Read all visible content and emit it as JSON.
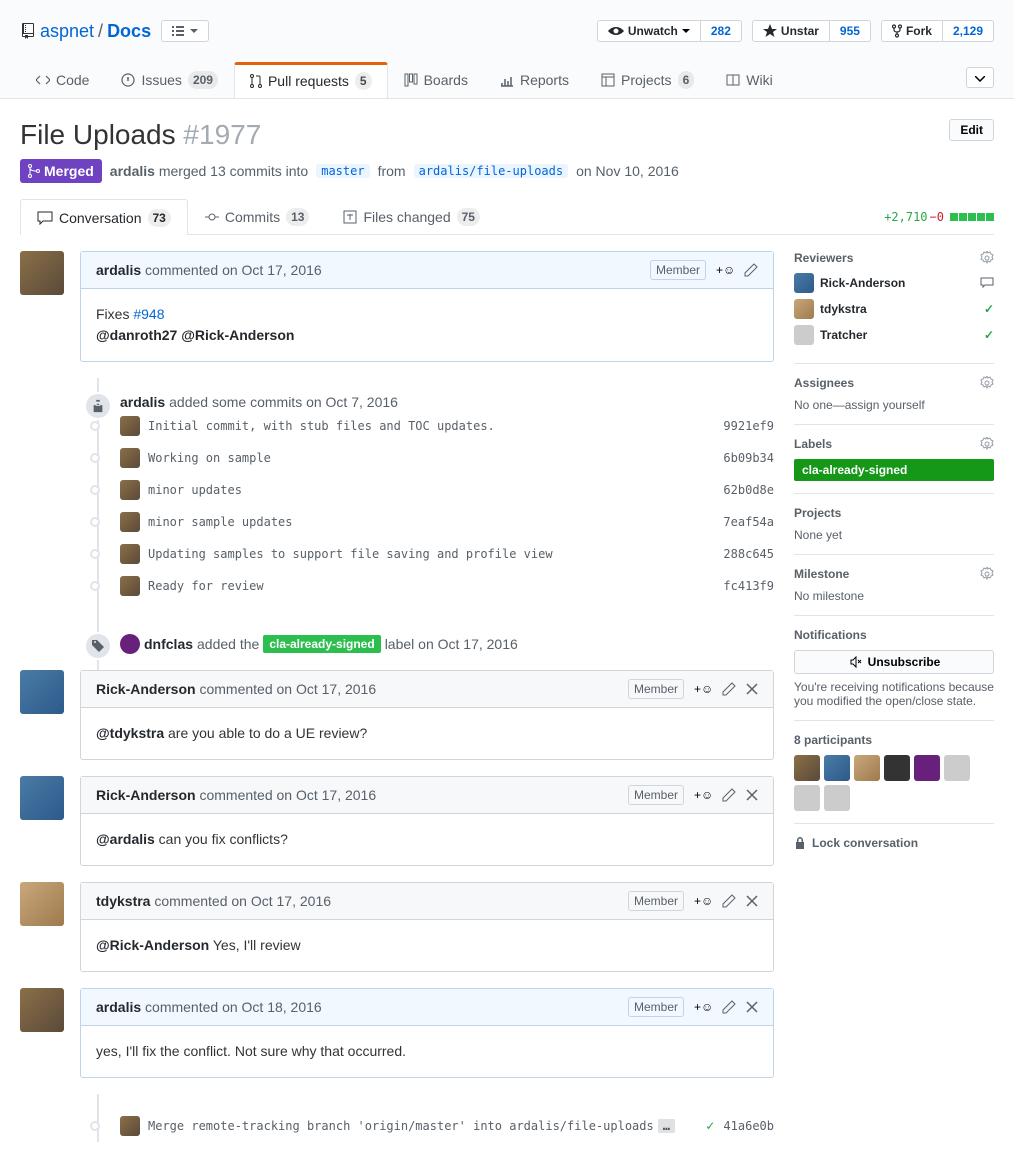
{
  "breadcrumb": {
    "owner": "aspnet",
    "repo": "Docs"
  },
  "actions": {
    "watch": {
      "label": "Unwatch",
      "count": "282"
    },
    "star": {
      "label": "Unstar",
      "count": "955"
    },
    "fork": {
      "label": "Fork",
      "count": "2,129"
    }
  },
  "nav": {
    "code": "Code",
    "issues": {
      "label": "Issues",
      "count": "209"
    },
    "pulls": {
      "label": "Pull requests",
      "count": "5"
    },
    "boards": "Boards",
    "reports": "Reports",
    "projects": {
      "label": "Projects",
      "count": "6"
    },
    "wiki": "Wiki"
  },
  "header": {
    "title": "File Uploads",
    "number": "#1977",
    "edit": "Edit"
  },
  "meta": {
    "state": "Merged",
    "author": "ardalis",
    "text1": "merged 13 commits into",
    "base": "master",
    "text2": "from",
    "head": "ardalis/file-uploads",
    "date": "on Nov 10, 2016"
  },
  "tabs": {
    "conversation": {
      "label": "Conversation",
      "count": "73"
    },
    "commits": {
      "label": "Commits",
      "count": "13"
    },
    "files": {
      "label": "Files changed",
      "count": "75"
    },
    "diff_add": "+2,710",
    "diff_del": "−0"
  },
  "timeline": {
    "c1": {
      "author": "ardalis",
      "meta": "commented on Oct 17, 2016",
      "badge": "Member",
      "body_pre": "Fixes ",
      "issue": "#948",
      "m1": "@danroth27",
      "m2": "@Rick-Anderson"
    },
    "commits_header": {
      "author": "ardalis",
      "text": "added some commits on Oct 7, 2016"
    },
    "commits": [
      {
        "msg": "Initial commit, with stub files and TOC updates.",
        "sha": "9921ef9"
      },
      {
        "msg": "Working on sample",
        "sha": "6b09b34"
      },
      {
        "msg": "minor updates",
        "sha": "62b0d8e"
      },
      {
        "msg": "minor sample updates",
        "sha": "7eaf54a"
      },
      {
        "msg": "Updating samples to support file saving and profile view",
        "sha": "288c645"
      },
      {
        "msg": "Ready for review",
        "sha": "fc413f9"
      }
    ],
    "label_event": {
      "author": "dnfclas",
      "text1": "added the",
      "label": "cla-already-signed",
      "text2": "label on Oct 17, 2016"
    },
    "c2": {
      "author": "Rick-Anderson",
      "meta": "commented on Oct 17, 2016",
      "badge": "Member",
      "m": "@tdykstra",
      "body": " are you able to do a UE review?"
    },
    "c3": {
      "author": "Rick-Anderson",
      "meta": "commented on Oct 17, 2016",
      "badge": "Member",
      "m": "@ardalis",
      "body": " can you fix conflicts?"
    },
    "c4": {
      "author": "tdykstra",
      "meta": "commented on Oct 17, 2016",
      "badge": "Member",
      "m": "@Rick-Anderson",
      "body": " Yes, I'll review"
    },
    "c5": {
      "author": "ardalis",
      "meta": "commented on Oct 18, 2016",
      "badge": "Member",
      "body": "yes, I'll fix the conflict. Not sure why that occurred."
    },
    "merge_commit": {
      "msg": "Merge remote-tracking branch 'origin/master' into ardalis/file-uploads",
      "sha": "41a6e0b"
    }
  },
  "sidebar": {
    "reviewers": {
      "title": "Reviewers",
      "r1": "Rick-Anderson",
      "r2": "tdykstra",
      "r3": "Tratcher"
    },
    "assignees": {
      "title": "Assignees",
      "text": "No one—assign yourself"
    },
    "labels": {
      "title": "Labels",
      "label": "cla-already-signed"
    },
    "projects": {
      "title": "Projects",
      "text": "None yet"
    },
    "milestone": {
      "title": "Milestone",
      "text": "No milestone"
    },
    "notifications": {
      "title": "Notifications",
      "btn": "Unsubscribe",
      "text": "You're receiving notifications because you modified the open/close state."
    },
    "participants": {
      "title": "8 participants"
    },
    "lock": "Lock conversation"
  }
}
